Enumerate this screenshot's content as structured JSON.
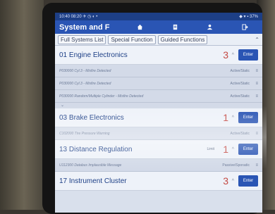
{
  "status_bar": {
    "left": "10:40  08:20  ✈ ◷ ◐ •",
    "right": "◆ ▾ ▪ 37%"
  },
  "app": {
    "title": "System and F"
  },
  "tabs": [
    {
      "label": "Full Systems List"
    },
    {
      "label": "Special Function"
    },
    {
      "label": "Guided Functions"
    }
  ],
  "groups": [
    {
      "name": "01 Engine Electronics",
      "count": "3",
      "enter": "Enter",
      "dtcs": [
        {
          "desc": "P030000 Cyl.3 - Misfire Detected",
          "status": "Active/Static"
        },
        {
          "desc": "P030000 Cyl.3 - Misfire Detected",
          "status": "Active/Static"
        },
        {
          "desc": "P030000 Random/Multiple Cylinder - Misfire Detected",
          "status": "Active/Static"
        }
      ]
    },
    {
      "name": "03 Brake Electronics",
      "count": "1",
      "enter": "Enter",
      "dtcs": [
        {
          "desc": "C102000 Tire Pressure Warning",
          "status": "Active/Static"
        }
      ]
    },
    {
      "name": "13 Distance Regulation",
      "count": "1",
      "extra": "Limit",
      "enter": "Enter",
      "dtcs": [
        {
          "desc": "U112300 Databus Implausible Message",
          "status": "Passive/Sporadic"
        }
      ]
    },
    {
      "name": "17 Instrument Cluster",
      "count": "3",
      "enter": "Enter",
      "dtcs": []
    }
  ],
  "icons": {
    "home": "home-icon",
    "doc": "document-icon",
    "people": "people-icon",
    "exit": "exit-icon"
  }
}
